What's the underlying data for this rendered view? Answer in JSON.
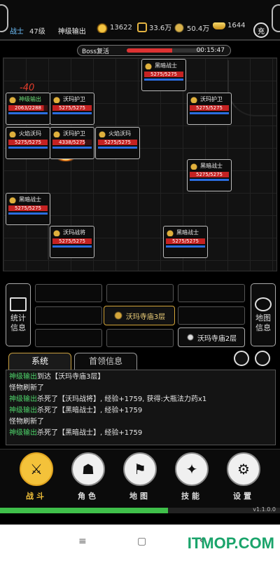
{
  "status": {
    "class_label": "战士",
    "level": "47级",
    "player_title": "神级输出",
    "power": "13622",
    "coins": "33.6万",
    "gems": "50.4万",
    "gold": "1644",
    "recharge_label": "充"
  },
  "boss": {
    "label": "Boss复活",
    "timer": "00:15:47",
    "progress": 0.6
  },
  "battle": {
    "damage_text": "-40",
    "cards": [
      {
        "name": "神级输出",
        "hp": "2063/2288",
        "player": true
      },
      {
        "name": "沃玛护卫",
        "hp": "5275/5275"
      },
      {
        "name": "黑暗战士",
        "hp": "5275/5275"
      },
      {
        "name": "沃玛护卫",
        "hp": "5275/5275"
      },
      {
        "name": "火焰沃玛",
        "hp": "5275/5275"
      },
      {
        "name": "沃玛护卫",
        "hp": "4338/5275"
      },
      {
        "name": "火焰沃玛",
        "hp": "5275/5275"
      },
      {
        "name": "黑暗战士",
        "hp": "5275/5275"
      },
      {
        "name": "黑暗战士",
        "hp": "5275/5275"
      },
      {
        "name": "沃玛战将",
        "hp": "5275/5275"
      },
      {
        "name": "黑暗战士",
        "hp": "5275/5275"
      }
    ]
  },
  "map_panel": {
    "stats_label": "统计信息",
    "map_info_label": "地图信息",
    "current_location": "沃玛寺庙3层",
    "next_location": "沃玛寺庙2层"
  },
  "messages": {
    "tab_system": "系统",
    "tab_boss": "首领信息",
    "lines": [
      {
        "who": "神级输出",
        "text": "到达【沃玛寺庙3层】"
      },
      {
        "who": "",
        "text": "怪物刷新了"
      },
      {
        "who": "神级输出",
        "text": "杀死了【沃玛战将】, 经验+1759, 获得:大瓶法力药x1"
      },
      {
        "who": "神级输出",
        "text": "杀死了【黑暗战士】, 经验+1759"
      },
      {
        "who": "",
        "text": "怪物刷新了"
      },
      {
        "who": "神级输出",
        "text": "杀死了【黑暗战士】, 经验+1759"
      }
    ]
  },
  "nav": {
    "items": [
      "战斗",
      "角色",
      "地图",
      "技能",
      "设置"
    ],
    "active": 0
  },
  "exp_progress": 0.6,
  "version": "v1.1.0.0",
  "system_nav": {
    "menu": "≡",
    "home": "▢",
    "back": "‹"
  },
  "watermark": "ITMOP.COM"
}
